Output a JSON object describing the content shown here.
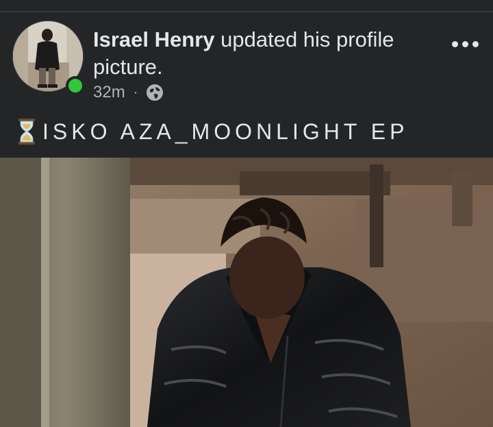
{
  "post": {
    "author": "Israel Henry",
    "action": "updated his profile picture.",
    "time": "32m",
    "separator": "·",
    "privacy_icon": "globe-icon",
    "more_icon": "more-options-icon",
    "online_color": "#31c737"
  },
  "caption": {
    "icon": "hourglass-icon",
    "text": "ISKO AZA_MOONLIGHT EP"
  },
  "photo": {
    "kind": "profile-picture"
  }
}
